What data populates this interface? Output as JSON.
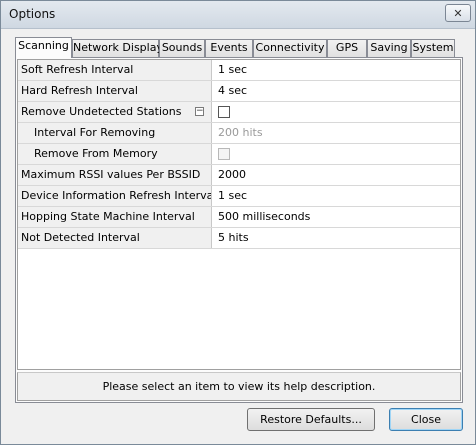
{
  "window": {
    "title": "Options",
    "close_glyph": "✕"
  },
  "tabs": [
    {
      "label": "Scanning",
      "active": true
    },
    {
      "label": "Network Display"
    },
    {
      "label": "Sounds"
    },
    {
      "label": "Events"
    },
    {
      "label": "Connectivity"
    },
    {
      "label": "GPS"
    },
    {
      "label": "Saving"
    },
    {
      "label": "System"
    }
  ],
  "properties": [
    {
      "name": "Soft Refresh Interval",
      "value": "1 sec"
    },
    {
      "name": "Hard Refresh Interval",
      "value": "4 sec"
    },
    {
      "name": "Remove Undetected Stations",
      "type": "checkbox",
      "checked": false,
      "expander": "−"
    },
    {
      "name": "Interval For Removing",
      "value": "200 hits",
      "disabled": true
    },
    {
      "name": "Remove From Memory",
      "type": "checkbox",
      "checked": false,
      "disabled": true
    },
    {
      "name": "Maximum RSSI values Per BSSID",
      "value": "2000"
    },
    {
      "name": "Device Information Refresh Interval",
      "value": "1 sec"
    },
    {
      "name": "Hopping State Machine Interval",
      "value": "500 milliseconds"
    },
    {
      "name": "Not Detected Interval",
      "value": "5 hits"
    }
  ],
  "help": {
    "text": "Please select an item to view its help description."
  },
  "buttons": {
    "restore_label": "Restore Defaults...",
    "close_label": "Close"
  }
}
